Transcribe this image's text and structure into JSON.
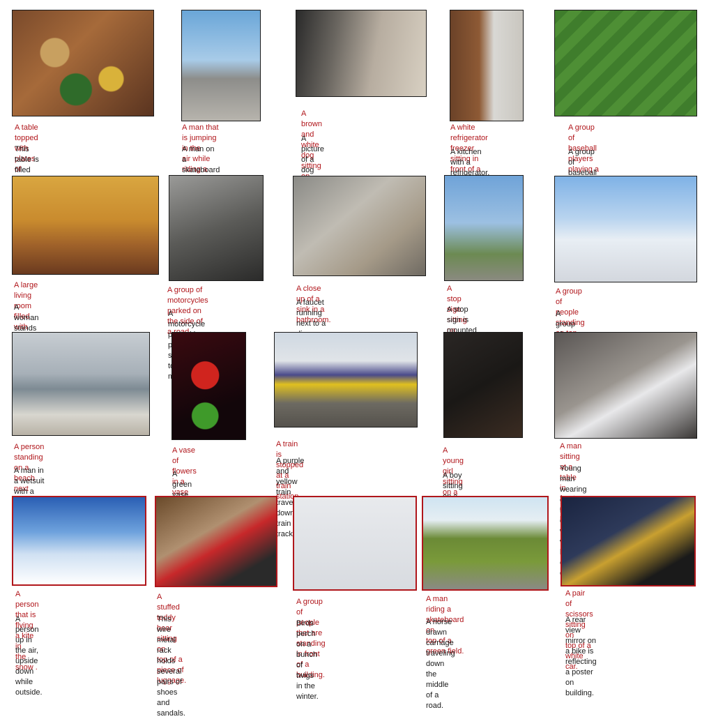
{
  "items": [
    {
      "generated": "A table topped with plates of\nfood and bowls of food.",
      "ground_truth": "This table is filled with a variety\nof different dishes."
    },
    {
      "generated": "A man that is jumping in the\nair while riding a skateboard.",
      "ground_truth": "A man on a skateboard is\nperforming a trick at the park."
    },
    {
      "generated": "A brown and white dog\nsitting on top of a street .",
      "ground_truth": "A picture of a dog laying\non the ground."
    },
    {
      "generated": "A white refrigerator freezer\nsitting in front of a stove.",
      "ground_truth": "A kitchen with a refrigerator,\nstove and oven with cabinets."
    },
    {
      "generated": "A group of baseball players\nplaying a game of baseball.",
      "ground_truth": "A group of baseball players is\ncrowded at the mound."
    },
    {
      "generated": "A large living room filled with\nfurniture and a flat screen tv.",
      "ground_truth": "A woman stands in the\ndining area at the table."
    },
    {
      "generated": "A group of motorcycles\nparked on the side of a road.",
      "ground_truth": "A motorcycle parked in a parking\nspace next to another motorcycle."
    },
    {
      "generated": "A close up of a sink in a bathroom.",
      "ground_truth": "A faucet running next to a dinosuar\nholding a toothbrush."
    },
    {
      "generated": "A stop sign sitting on the\nside of a road.",
      "ground_truth": "A stop sign is mounted\nupside-down on it's post."
    },
    {
      "generated": "A group of people standing on top of a\nsnow covered slope.",
      "ground_truth": "A group of people riding skis on top of\na ski slope."
    },
    {
      "generated": "A person standing on a beach next\nto a surfboard in the ocean.",
      "ground_truth": "A man in a wetsuit with a\nsurfboard standing on a beach."
    },
    {
      "generated": "A vase of flowers in a\nvase on a table.",
      "ground_truth": "A green vase filed with red\nroses sitting on top of table."
    },
    {
      "generated": "A train is stopped at a train station.",
      "ground_truth": "A purple and yellow train\ntraveling down train tracks."
    },
    {
      "generated": "A young girl sitting on a\ncouch with a teddy bear.",
      "ground_truth": "A boy sitting on a black\ncouch with teddy bears."
    },
    {
      "generated": "A man sitting at a table in front of a\nlaptop.",
      "ground_truth": "Young man wearing glasses\nlounging on a sofa with three white\nlaptop computers on his lap."
    },
    {
      "generated": "A person that is flying a kite in\nthe snow .",
      "ground_truth": "A person up in the air, upside\ndown while outside."
    },
    {
      "generated": "A stuffed teddy bear sitting on\ntop of a piece of luggage.",
      "ground_truth": "This wire metal rack holds several\npairs of shoes and sandals."
    },
    {
      "generated": "A group of people that are\nstanding in front of a building.",
      "ground_truth": "Birds perch on a bunch of twigs\nin the winter."
    },
    {
      "generated": "A man riding a skateboard on\ntop of a green field.",
      "ground_truth": "A horse drawn carriage traveling\ndown the middle of a road."
    },
    {
      "generated": "A pair of scissors sitting on\ntop of a white car.",
      "ground_truth": "A rear view mirror on a bike is\nreflecting a poster on building."
    }
  ]
}
